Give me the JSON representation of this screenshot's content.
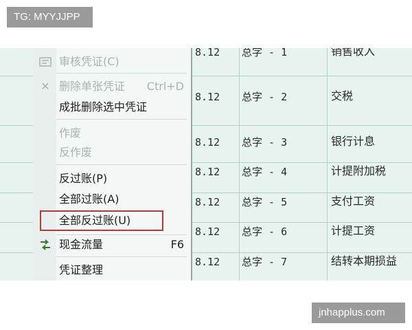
{
  "watermarks": {
    "top_left": "TG: MYYJJPP",
    "bottom_right": "jnhapplus.com"
  },
  "menu": {
    "items": [
      {
        "label": "审核凭证(C)",
        "disabled": true,
        "icon": "review-icon"
      },
      {
        "label": "删除单张凭证",
        "shortcut": "Ctrl+D",
        "disabled": true,
        "icon": "delete-x-icon"
      },
      {
        "label": "成批删除选中凭证",
        "disabled": false
      },
      {
        "label": "作废",
        "disabled": true
      },
      {
        "label": "反作废",
        "disabled": true
      },
      {
        "label": "反过账(P)",
        "disabled": false
      },
      {
        "label": "全部过账(A)",
        "disabled": false
      },
      {
        "label": "全部反过账(U)",
        "disabled": false,
        "highlighted": true
      },
      {
        "label": "现金流量",
        "shortcut": "F6",
        "disabled": false,
        "icon": "cash-flow-icon"
      },
      {
        "label": "凭证整理",
        "disabled": false
      }
    ],
    "highlight_color": "#b53a3a"
  },
  "table": {
    "rows": [
      {
        "date": "8.12",
        "voucher": "总字 - 1",
        "summary": "销售收入"
      },
      {
        "date": "8.12",
        "voucher": "总字 - 2",
        "summary": "交税"
      },
      {
        "date": "8.12",
        "voucher": "总字 - 3",
        "summary": "银行计息"
      },
      {
        "date": "8.12",
        "voucher": "总字 - 4",
        "summary": "计提附加税"
      },
      {
        "date": "8.12",
        "voucher": "总字 - 5",
        "summary": "支付工资"
      },
      {
        "date": "8.12",
        "voucher": "总字 - 6",
        "summary": "计提工资"
      },
      {
        "date": "8.12",
        "voucher": "总字 - 7",
        "summary": "结转本期损益"
      }
    ]
  }
}
